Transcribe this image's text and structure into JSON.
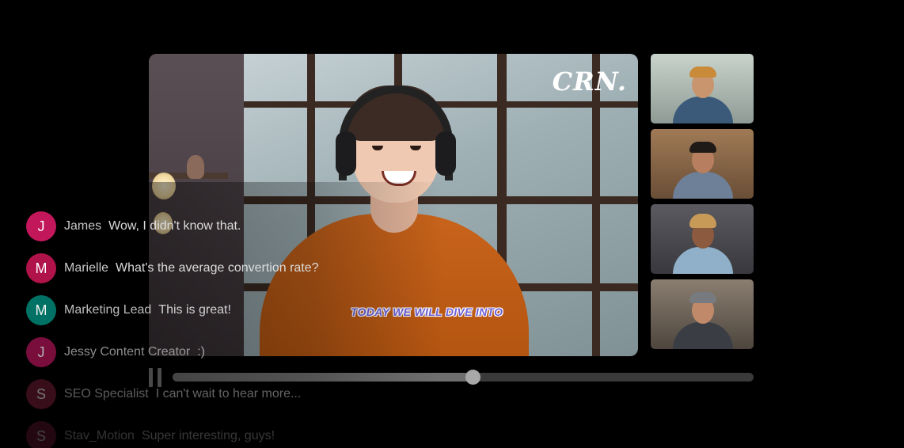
{
  "stream": {
    "logo_text": "CRN.",
    "caption_text": "TODAY WE WILL DIVE INTO",
    "progress_fraction": 0.516
  },
  "participants": [
    {
      "id": "participant-1",
      "hat_color": "#c98a3a",
      "shirt_color": "#3b5a7a",
      "bg": "#9aa7a0"
    },
    {
      "id": "participant-2",
      "hat_color": "#1f1a18",
      "shirt_color": "#6e7f98",
      "bg": "#8a6a4e"
    },
    {
      "id": "participant-3",
      "hat_color": "#c89a58",
      "shirt_color": "#8fb0c8",
      "bg": "#4c4c52"
    },
    {
      "id": "participant-4",
      "hat_color": "#777a7e",
      "shirt_color": "#3a3e44",
      "bg": "#6e6358"
    }
  ],
  "chat": {
    "messages": [
      {
        "initial": "J",
        "name": "James",
        "text": "Wow, I didn't know that.",
        "color": "#c2185b"
      },
      {
        "initial": "M",
        "name": "Marielle",
        "text": "What's the average convertion rate?",
        "color": "#b0134a"
      },
      {
        "initial": "M",
        "name": "Marketing Lead",
        "text": "This is great!",
        "color": "#00796b"
      },
      {
        "initial": "J",
        "name": "Jessy Content Creator",
        "text": ":)",
        "color": "#ad1457"
      },
      {
        "initial": "S",
        "name": "SEO Specialist",
        "text": "I can't wait to hear more...",
        "color": "#7b1f3a"
      },
      {
        "initial": "S",
        "name": "Stav_Motion",
        "text": "Super interesting, guys!",
        "color": "#8a2146"
      }
    ]
  }
}
